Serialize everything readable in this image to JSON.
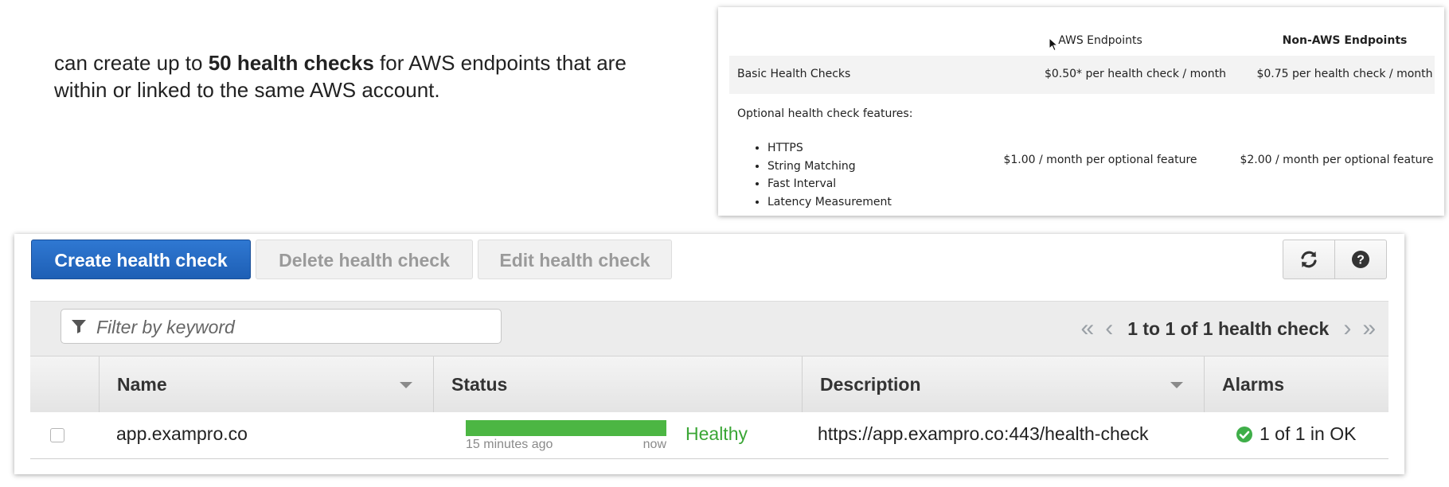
{
  "intro": {
    "before": "can create up to ",
    "bold": "50 health checks",
    "after": " for AWS endpoints that are within or linked to the same AWS account."
  },
  "pricing": {
    "col_aws": "AWS Endpoints",
    "col_non_aws": "Non-AWS Endpoints",
    "basic_label": "Basic Health Checks",
    "basic_aws": "$0.50* per health check / month",
    "basic_non_aws": "$0.75 per health check / month",
    "optional_label": "Optional health check features:",
    "optional_features": [
      "HTTPS",
      "String Matching",
      "Fast Interval",
      "Latency Measurement"
    ],
    "optional_aws": "$1.00 / month per optional feature",
    "optional_non_aws": "$2.00 / month per optional feature"
  },
  "toolbar": {
    "create_label": "Create health check",
    "delete_label": "Delete health check",
    "edit_label": "Edit health check",
    "refresh_icon": "refresh-icon",
    "help_icon": "help-icon"
  },
  "filter": {
    "placeholder": "Filter by keyword",
    "value": ""
  },
  "pagination": {
    "text": "1 to 1 of 1 health check"
  },
  "table": {
    "columns": [
      "",
      "Name",
      "Status",
      "Description",
      "Alarms"
    ],
    "rows": [
      {
        "name": "app.exampro.co",
        "status_bar_fill": 1.0,
        "status_from": "15 minutes ago",
        "status_to": "now",
        "status": "Healthy",
        "description": "https://app.exampro.co:443/health-check",
        "alarms": "1 of 1 in OK"
      }
    ]
  },
  "colors": {
    "primary_button": "#1e5fb5",
    "healthy": "#3aa635",
    "status_bar": "#4cb643",
    "ok_icon": "#3fae49"
  }
}
